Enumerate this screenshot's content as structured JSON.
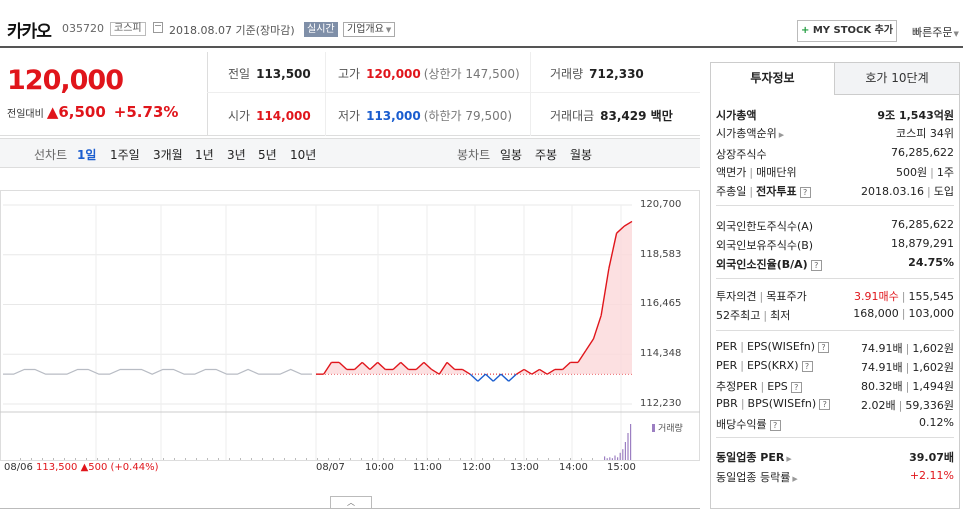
{
  "header": {
    "stock_name": "카카오",
    "stock_code": "035720",
    "market": "코스피",
    "date": "2018.08.07  기준(장마감)",
    "realtime": "실시간",
    "corp_overview": "기업개요",
    "mystock_plus": "+",
    "mystock_label": "MY STOCK 추가",
    "quick_order": "빠른주문"
  },
  "summary": {
    "price": "120,000",
    "change_label": "전일대비",
    "change_value": "▲6,500",
    "change_pct": "+5.73%",
    "prev_label": "전일",
    "prev_value": "113,500",
    "high_label": "고가",
    "high_value": "120,000",
    "upper_limit": "(상한가 147,500)",
    "volume_label": "거래량",
    "volume_value": "712,330",
    "open_label": "시가",
    "open_value": "114,000",
    "low_label": "저가",
    "low_value": "113,000",
    "lower_limit": "(하한가 79,500)",
    "amount_label": "거래대금",
    "amount_value": "83,429 백만"
  },
  "period_bar": {
    "line_label": "선차트",
    "line_periods": [
      "1일",
      "1주일",
      "3개월",
      "1년",
      "3년",
      "5년",
      "10년"
    ],
    "selected": "1일",
    "candle_label": "봉차트",
    "candle_periods": [
      "일봉",
      "주봉",
      "월봉"
    ]
  },
  "chart_data": {
    "type": "line",
    "y_ticks": [
      "120,700",
      "118,583",
      "116,465",
      "114,348",
      "112,230"
    ],
    "ylim": [
      112230,
      120700
    ],
    "x_ticks": [
      "08/06",
      "08/07",
      "10:00",
      "11:00",
      "12:00",
      "13:00",
      "14:00",
      "15:00"
    ],
    "prev_close": 113500,
    "prev_day_close_text": "08/06",
    "prev_day_price": "113,500",
    "prev_day_change": "▲500 (+0.44%)",
    "volume_legend": "거래량",
    "series": [
      {
        "values": [
          113500,
          113500,
          113700,
          113700,
          113500,
          113500,
          113500,
          113700,
          113700,
          113500,
          113500,
          113700,
          113700,
          113700,
          113500,
          113700,
          113700,
          113500,
          113500,
          113700,
          113700,
          113500,
          113500,
          113700,
          113500,
          113500,
          113500,
          113700,
          113500,
          113500
        ]
      },
      {
        "values": [
          113500,
          113500,
          114000,
          114000,
          113700,
          113700,
          114000,
          113700,
          114000,
          113700,
          113700,
          114000,
          113700,
          113700,
          114000,
          113700,
          113500,
          114000,
          113700,
          113700,
          113500,
          113200,
          113500,
          113200,
          113500,
          113200,
          113500,
          113700,
          113500,
          113700,
          113500,
          113700,
          113700,
          114000,
          114000,
          114500,
          115000,
          116000,
          118000,
          119500,
          119800,
          120000
        ]
      }
    ]
  },
  "chart_ui": {
    "toggle": "︿"
  },
  "right_panel": {
    "tab_invest": "투자정보",
    "tab_hoga": "호가 10단계",
    "rows1": [
      {
        "k": "시가총액",
        "v": "9조 1,543억원"
      },
      {
        "k": "시가총액순위",
        "v": "코스피 34위"
      },
      {
        "k": "상장주식수",
        "v": "76,285,622"
      },
      {
        "k": "액면가",
        "k2": "매매단위",
        "v": "500원",
        "v2": "1주"
      },
      {
        "k": "주총일",
        "k2": "전자투표",
        "v": "2018.03.16",
        "v2": "도입"
      }
    ],
    "rows2": [
      {
        "k": "외국인한도주식수(A)",
        "v": "76,285,622"
      },
      {
        "k": "외국인보유주식수(B)",
        "v": "18,879,291"
      },
      {
        "k": "외국인소진율(B/A)",
        "v": "24.75%"
      }
    ],
    "rows3": [
      {
        "k": "투자의견",
        "k2": "목표주가",
        "v": "3.91매수",
        "v2": "155,545"
      },
      {
        "k": "52주최고",
        "k2": "최저",
        "v": "168,000",
        "v2": "103,000"
      }
    ],
    "rows4": [
      {
        "k": "PER",
        "k2": "EPS(WISEfn)",
        "v": "74.91배",
        "v2": "1,602원"
      },
      {
        "k": "PER",
        "k2": "EPS(KRX)",
        "v": "74.91배",
        "v2": "1,602원"
      },
      {
        "k": "추정PER",
        "k2": "EPS",
        "v": "80.32배",
        "v2": "1,494원"
      },
      {
        "k": "PBR",
        "k2": "BPS(WISEfn)",
        "v": "2.02배",
        "v2": "59,336원"
      },
      {
        "k": "배당수익률",
        "v": "0.12%"
      }
    ],
    "rows5": [
      {
        "k": "동일업종 PER",
        "v": "39.07배"
      },
      {
        "k": "동일업종 등락률",
        "v": "+2.11%"
      }
    ]
  },
  "colors": {
    "up": "#e0151b",
    "down": "#1a5dcf",
    "prev_line": "#b8bcc4",
    "volume": "#9c7fc2"
  }
}
